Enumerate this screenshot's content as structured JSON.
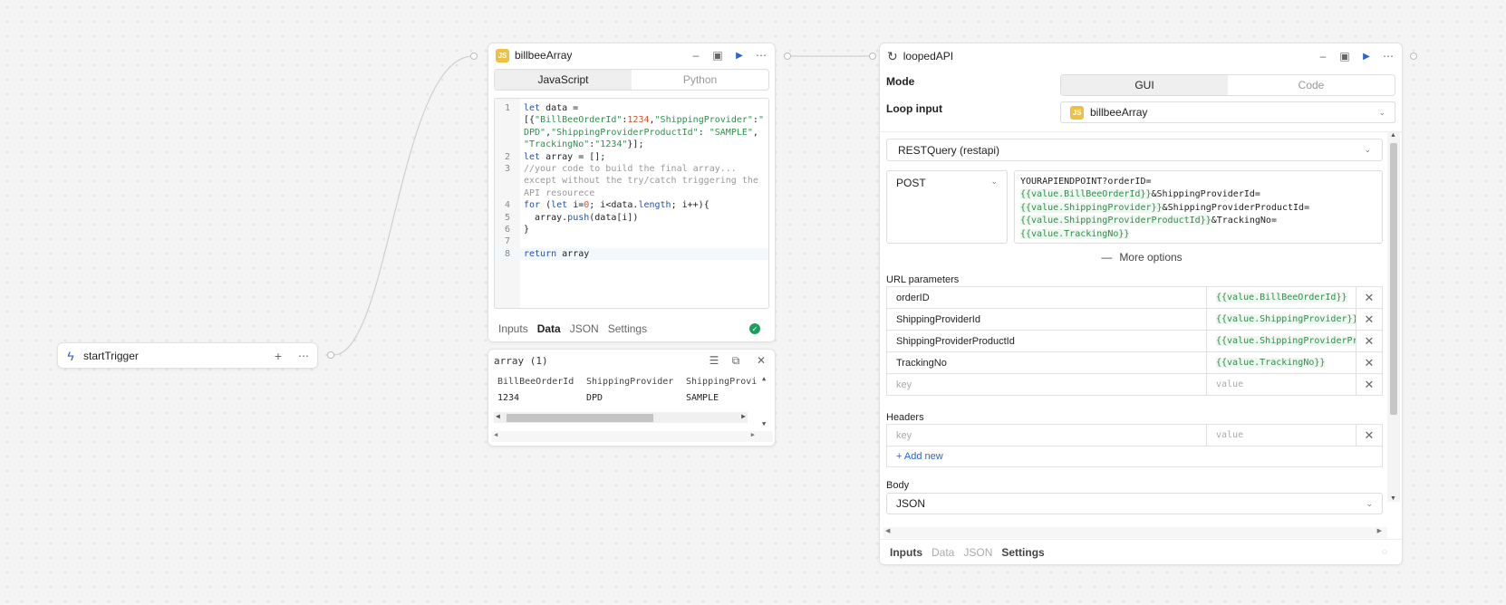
{
  "start_trigger": {
    "title": "startTrigger"
  },
  "billbee": {
    "title": "billbeeArray",
    "lang_tabs": [
      "JavaScript",
      "Python"
    ],
    "code_lines": [
      {
        "n": "1",
        "html": "<span class=\"kw\">let</span> data ="
      },
      {
        "n": "",
        "html": "[{<span class=\"str\">\"BillBeeOrderId\"</span>:<span class=\"num\">1234</span>,<span class=\"str\">\"ShippingProvider\"</span>:<span class=\"str\">\"</span>"
      },
      {
        "n": "",
        "html": "<span class=\"str\">DPD\"</span>,<span class=\"str\">\"ShippingProviderProductId\"</span>: <span class=\"str\">\"SAMPLE\"</span>,"
      },
      {
        "n": "",
        "html": "<span class=\"str\">\"TrackingNo\"</span>:<span class=\"str\">\"1234\"</span>}];"
      },
      {
        "n": "2",
        "html": "<span class=\"kw\">let</span> array = [];"
      },
      {
        "n": "3",
        "html": "<span class=\"cmt\">//your code to build the final array...</span>"
      },
      {
        "n": "",
        "html": "<span class=\"cmt\">except without the try/catch triggering the</span>"
      },
      {
        "n": "",
        "html": "<span class=\"cmt\">API resourece</span>"
      },
      {
        "n": "4",
        "html": "<span class=\"kw\">for</span> (<span class=\"kw\">let</span> i=<span class=\"num\">0</span>; i&lt;data.<span class=\"kw\">length</span>; i++){"
      },
      {
        "n": "5",
        "html": "&nbsp;&nbsp;array.<span class=\"kw\">push</span>(data[i])"
      },
      {
        "n": "6",
        "html": "}"
      },
      {
        "n": "7",
        "html": ""
      },
      {
        "n": "8",
        "html": "<span class=\"kw\">return</span> array"
      }
    ],
    "bottom_tabs": [
      "Inputs",
      "Data",
      "JSON",
      "Settings"
    ],
    "active_tab": "Data"
  },
  "array_preview": {
    "title": "array (1)",
    "columns": [
      "BillBeeOrderId",
      "ShippingProvider",
      "ShippingProvi"
    ],
    "row": [
      "1234",
      "DPD",
      "SAMPLE"
    ]
  },
  "looped": {
    "title": "loopedAPI",
    "mode_label": "Mode",
    "mode_options": [
      "GUI",
      "Code"
    ],
    "loop_input_label": "Loop input",
    "loop_input_value": "billbeeArray",
    "resource": "RESTQuery (restapi)",
    "method": "POST",
    "url_parts": [
      {
        "t": "YOURAPIENDPOINT?orderID=",
        "tmpl": false
      },
      {
        "t": "{{value.BillBeeOrderId}}",
        "tmpl": true
      },
      {
        "t": "&ShippingProviderId=",
        "tmpl": false
      },
      {
        "t": "{{value.ShippingProvider}}",
        "tmpl": true
      },
      {
        "t": "&ShippingProviderProductId=",
        "tmpl": false
      },
      {
        "t": "{{value.ShippingProviderProductId}}",
        "tmpl": true
      },
      {
        "t": "&TrackingNo=",
        "tmpl": false
      },
      {
        "t": "{{value.TrackingNo}}",
        "tmpl": true
      }
    ],
    "more_options": "More options",
    "url_params_label": "URL parameters",
    "url_params": [
      {
        "key": "orderID",
        "value": "{{value.BillBeeOrderId}}"
      },
      {
        "key": "ShippingProviderId",
        "value": "{{value.ShippingProvider}}"
      },
      {
        "key": "ShippingProviderProductId",
        "value": "{{value.ShippingProviderProductId}}"
      },
      {
        "key": "TrackingNo",
        "value": "{{value.TrackingNo}}"
      }
    ],
    "key_placeholder": "key",
    "value_placeholder": "value",
    "headers_label": "Headers",
    "add_new": "+ Add new",
    "body_label": "Body",
    "body_type": "JSON",
    "bottom_tabs": [
      "Inputs",
      "Data",
      "JSON",
      "Settings"
    ]
  }
}
